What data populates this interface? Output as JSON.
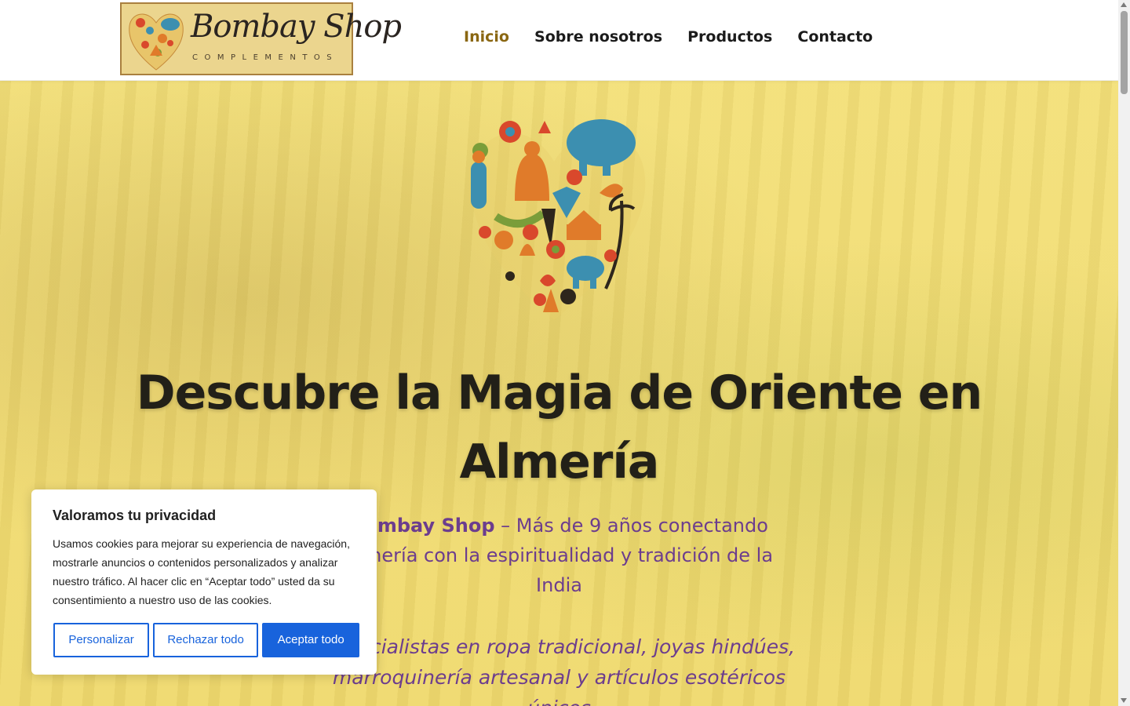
{
  "header": {
    "logo": {
      "name": "Bombay Shop",
      "tagline": "COMPLEMENTOS"
    },
    "nav": [
      {
        "label": "Inicio",
        "active": true
      },
      {
        "label": "Sobre nosotros",
        "active": false
      },
      {
        "label": "Productos",
        "active": false
      },
      {
        "label": "Contacto",
        "active": false
      }
    ]
  },
  "hero": {
    "image": "heart-of-india-icons",
    "title": "Descubre la Magia de Oriente en Almería",
    "subtitle_brand": "Bombay Shop",
    "subtitle_rest": " – Más de 9 años conectando Almería con la espiritualidad y tradición de la India",
    "specialties": "Especialistas en ropa tradicional, joyas hindúes, marroquinería artesanal y artículos esotéricos únicos"
  },
  "cookie_banner": {
    "title": "Valoramos tu privacidad",
    "text": "Usamos cookies para mejorar su experiencia de navegación, mostrarle anuncios o contenidos personalizados y analizar nuestro tráfico. Al hacer clic en “Aceptar todo” usted da su consentimiento a nuestro uso de las cookies.",
    "buttons": {
      "customize": "Personalizar",
      "reject": "Rechazar todo",
      "accept": "Aceptar todo"
    }
  },
  "colors": {
    "accent": "#8a6712",
    "subtitle": "#6c3d8e",
    "cookie_button": "#1863dc",
    "hero_bg": "#f1dc74"
  }
}
